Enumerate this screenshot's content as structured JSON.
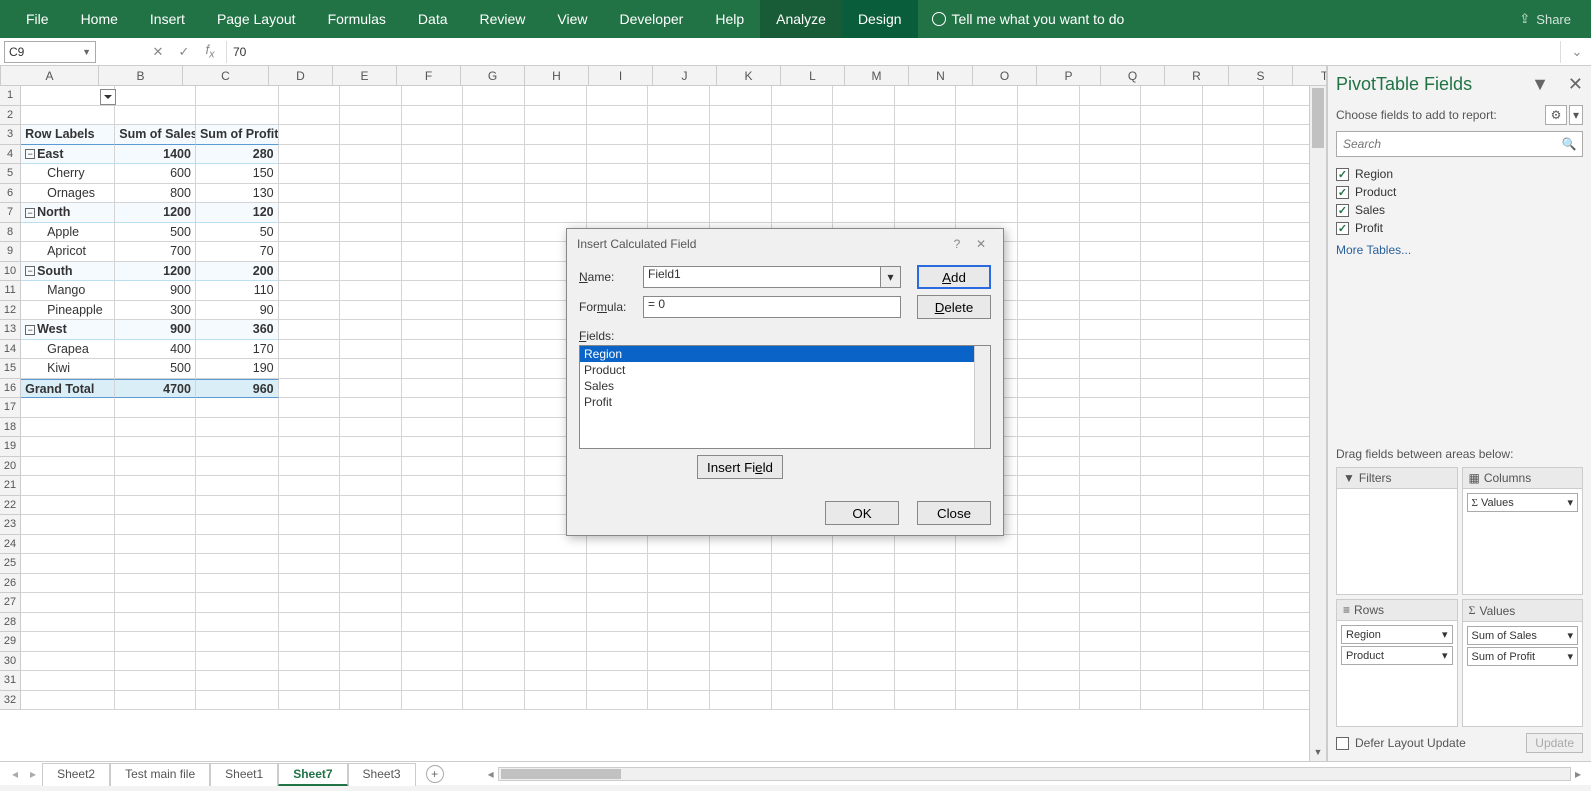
{
  "ribbon": {
    "tabs": [
      "File",
      "Home",
      "Insert",
      "Page Layout",
      "Formulas",
      "Data",
      "Review",
      "View",
      "Developer",
      "Help",
      "Analyze",
      "Design"
    ],
    "tellme": "Tell me what you want to do",
    "share": "Share"
  },
  "namebox": "C9",
  "formula_value": "70",
  "columns": [
    "A",
    "B",
    "C",
    "D",
    "E",
    "F",
    "G",
    "H",
    "I",
    "J",
    "K",
    "L",
    "M",
    "N",
    "O",
    "P",
    "Q",
    "R",
    "S",
    "T"
  ],
  "pivot": {
    "hdr": [
      "Row Labels",
      "Sum of Sales",
      "Sum of Profit"
    ],
    "rows": [
      {
        "t": "grp",
        "a": "East",
        "b": "1400",
        "c": "280"
      },
      {
        "t": "item",
        "a": "Cherry",
        "b": "600",
        "c": "150"
      },
      {
        "t": "item",
        "a": "Ornages",
        "b": "800",
        "c": "130"
      },
      {
        "t": "grp",
        "a": "North",
        "b": "1200",
        "c": "120"
      },
      {
        "t": "item",
        "a": "Apple",
        "b": "500",
        "c": "50"
      },
      {
        "t": "item",
        "a": "Apricot",
        "b": "700",
        "c": "70"
      },
      {
        "t": "grp",
        "a": "South",
        "b": "1200",
        "c": "200"
      },
      {
        "t": "item",
        "a": "Mango",
        "b": "900",
        "c": "110"
      },
      {
        "t": "item",
        "a": "Pineapple",
        "b": "300",
        "c": "90"
      },
      {
        "t": "grp",
        "a": "West",
        "b": "900",
        "c": "360"
      },
      {
        "t": "item",
        "a": "Grapea",
        "b": "400",
        "c": "170"
      },
      {
        "t": "item",
        "a": "Kiwi",
        "b": "500",
        "c": "190"
      }
    ],
    "total": {
      "a": "Grand Total",
      "b": "4700",
      "c": "960"
    }
  },
  "dialog": {
    "title": "Insert Calculated Field",
    "name_lbl": "Name:",
    "name_val": "Field1",
    "formula_lbl": "Formula:",
    "formula_val": "= 0",
    "fields_lbl": "Fields:",
    "fields": [
      "Region",
      "Product",
      "Sales",
      "Profit"
    ],
    "add": "Add",
    "delete": "Delete",
    "insert": "Insert Field",
    "ok": "OK",
    "close": "Close"
  },
  "pane": {
    "title": "PivotTable Fields",
    "sub": "Choose fields to add to report:",
    "search": "Search",
    "fields": [
      "Region",
      "Product",
      "Sales",
      "Profit"
    ],
    "more": "More Tables...",
    "drag": "Drag fields between areas below:",
    "filters": "Filters",
    "columns": "Columns",
    "rows": "Rows",
    "values": "Values",
    "col_item": "Values",
    "row_items": [
      "Region",
      "Product"
    ],
    "val_items": [
      "Sum of Sales",
      "Sum of Profit"
    ],
    "defer": "Defer Layout Update",
    "update": "Update"
  },
  "sheets": [
    "Sheet2",
    "Test main file",
    "Sheet1",
    "Sheet7",
    "Sheet3"
  ],
  "active_sheet": "Sheet7"
}
